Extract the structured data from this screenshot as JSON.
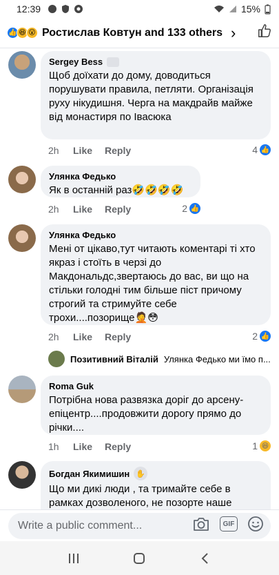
{
  "status_bar": {
    "time": "12:39",
    "battery": "15%"
  },
  "header": {
    "title": "Ростислав Ковтун and 133 others",
    "reactions": [
      "like",
      "haha",
      "wow"
    ]
  },
  "comments": [
    {
      "author": "Sergey Bess",
      "text": "Щоб доїхати до дому, доводиться порушувати правила, петляти. Організація руху нікудишня. Черга на макдрайв майже від монастиря по Івасюка",
      "time": "2h",
      "like_label": "Like",
      "reply_label": "Reply",
      "reaction_count": "4",
      "reaction_type": "like"
    },
    {
      "author": "Улянка Федько",
      "text": "Як в останній раз🤣🤣🤣🤣",
      "time": "2h",
      "like_label": "Like",
      "reply_label": "Reply",
      "reaction_count": "2",
      "reaction_type": "like"
    },
    {
      "author": "Улянка Федько",
      "text": "Мені от цікаво,тут читають коментарі ті хто якраз і стоїть в черзі до Макдональдс,звертаюсь до вас, ви що на стільки голодні тим більше піст причому строгий та стримуйте себе трохи....позорище🤦😳",
      "time": "2h",
      "like_label": "Like",
      "reply_label": "Reply",
      "reaction_count": "2",
      "reaction_type": "like",
      "reply_preview": {
        "name": "Позитивний Віталій",
        "text": "Улянка Федько ми їмо п..."
      }
    },
    {
      "author": "Roma Guk",
      "text": "Потрібна нова развязка доріг   до арсену-епіцентр....продовжити дорогу прямо до річки....",
      "time": "1h",
      "like_label": "Like",
      "reply_label": "Reply",
      "reaction_count": "1",
      "reaction_type": "haha"
    },
    {
      "author": "Богдан Якимишин",
      "text": "Що ми дикі люди , та тримайте себе в рамках дозволеного,  не позорте  наше",
      "time": "",
      "like_label": "",
      "reply_label": ""
    }
  ],
  "composer": {
    "placeholder": "Write a public comment..."
  },
  "icons": {
    "camera": "camera-icon",
    "gif": "GIF",
    "emoji": "emoji-icon",
    "nav_recent": "recent-apps-icon",
    "nav_home": "home-icon",
    "nav_back": "back-icon"
  }
}
